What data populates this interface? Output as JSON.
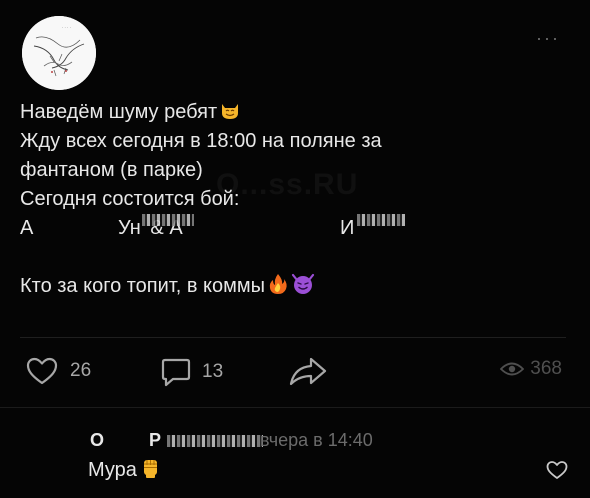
{
  "post": {
    "more_label": "···",
    "lines": {
      "l1": "Наведём шуму ребят",
      "l2": "Жду всех сегодня в 18:00 на поляне за",
      "l3": "фантаном (в парке)",
      "l4": "Сегодня состоится бой:",
      "fighter_1_initial": "А",
      "fighter_1_surname_start": "Ун",
      "fighter_2_amp": "& А",
      "fighter_2_surname_start": "И",
      "l6": "Кто за кого топит, в коммы"
    },
    "emojis": {
      "l1": "smiling-cat-emoji",
      "l6_a": "fire-emoji",
      "l6_b": "smiling-devil-emoji"
    },
    "watermark": "O...ss.RU",
    "likes": "26",
    "comments": "13",
    "views": "368"
  },
  "comment": {
    "author_initial": "О",
    "author_partial": "Р",
    "time": "вчера в 14:40",
    "text": "Мура",
    "emoji": "raised-fist-emoji"
  },
  "colors": {
    "background": "#050505",
    "text": "#e8e8e8",
    "muted": "#a7a7a7",
    "dim": "#4f4f4f"
  }
}
